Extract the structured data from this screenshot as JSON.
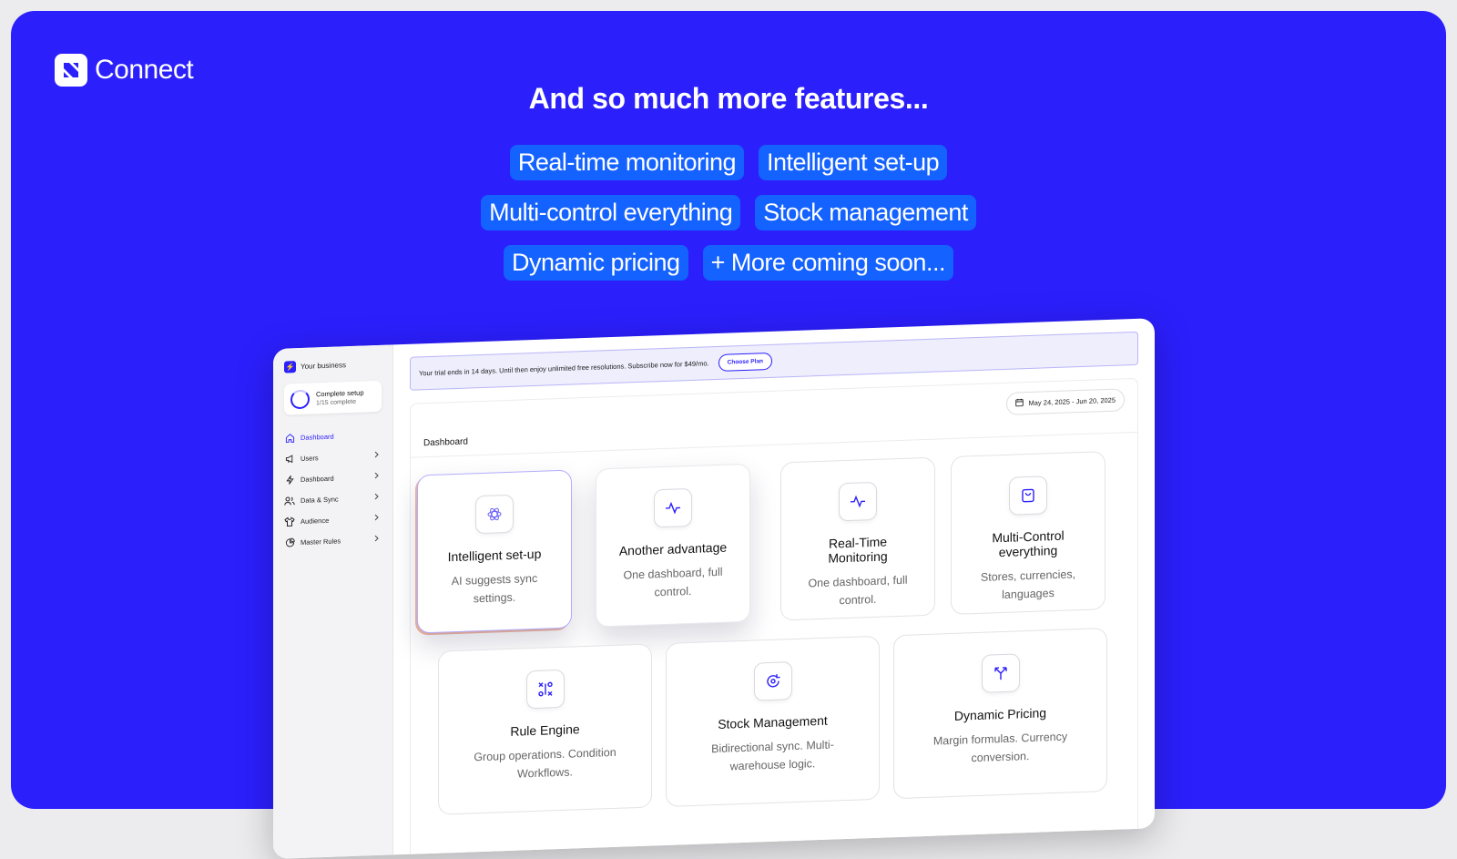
{
  "brand": {
    "name": "Connect"
  },
  "headline": "And so much more features...",
  "feature_pills": [
    [
      "Real-time monitoring",
      "Intelligent set-up"
    ],
    [
      "Multi-control everything",
      "Stock management"
    ],
    [
      "Dynamic pricing",
      "+ More coming soon..."
    ]
  ],
  "colors": {
    "brand": "#2b1ffc",
    "pill": "#1462ff"
  },
  "app": {
    "business": "Your business",
    "setup": {
      "title": "Complete setup",
      "progress": "1/15 complete"
    },
    "nav": [
      {
        "label": "Dashboard",
        "icon": "home-icon",
        "active": true
      },
      {
        "label": "Users",
        "icon": "megaphone-icon",
        "chevron": true
      },
      {
        "label": "Dashboard",
        "icon": "bolt-icon",
        "chevron": true
      },
      {
        "label": "Data & Sync",
        "icon": "users-icon",
        "chevron": true
      },
      {
        "label": "Audience",
        "icon": "shirt-icon",
        "chevron": true
      },
      {
        "label": "Master Rules",
        "icon": "pie-icon",
        "chevron": true
      }
    ],
    "trial": {
      "text": "Your trial ends in 14 days. Until then enjoy unlimited free resolutions. Subscribe now for $49/mo.",
      "button": "Choose Plan"
    },
    "date_range": "May 24, 2025 - Jun 20, 2025",
    "dashboard_title": "Dashboard",
    "cards": [
      {
        "title": "Intelligent set-up",
        "desc": "AI suggests sync settings.",
        "icon": "sparkle-icon"
      },
      {
        "title": "Another advantage",
        "desc": "One dashboard, full control.",
        "icon": "pulse-icon"
      },
      {
        "title": "Real-Time Monitoring",
        "desc": "One dashboard, full control.",
        "icon": "pulse-icon"
      },
      {
        "title": "Multi-Control everything",
        "desc": "Stores, currencies, languages",
        "icon": "bag-icon"
      },
      {
        "title": "Rule Engine",
        "desc": "Group operations. Condition Workflows.",
        "icon": "rules-icon"
      },
      {
        "title": "Stock Management",
        "desc": "Bidirectional sync. Multi-warehouse logic.",
        "icon": "sync-icon"
      },
      {
        "title": "Dynamic Pricing",
        "desc": "Margin formulas. Currency conversion.",
        "icon": "split-icon"
      }
    ]
  }
}
